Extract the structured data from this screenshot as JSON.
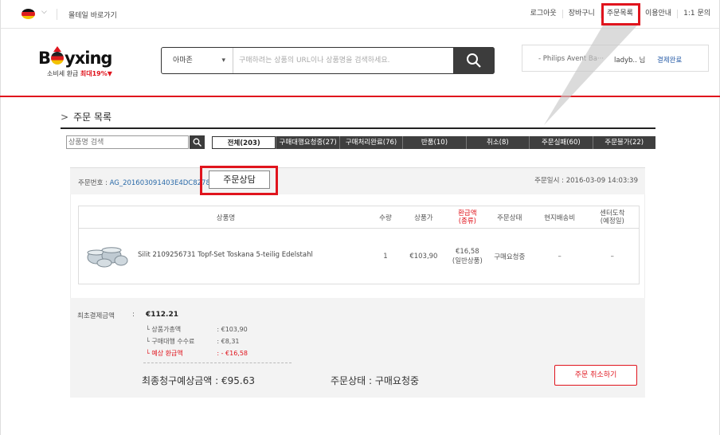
{
  "topbar": {
    "mall_link": "몰테일 바로가기",
    "nav": [
      "로그아웃",
      "장바구니",
      "주문목록",
      "이용안내",
      "1:1 문의"
    ]
  },
  "header": {
    "logo": "Byxing",
    "logo_sub_prefix": "소비세 환급 ",
    "logo_sub_highlight": "최대19%▼",
    "search_site": "아마존",
    "search_placeholder": "구매하려는 상품의 URL이나 상품명을 검색하세요.",
    "ticker_product": "- Philips Avent Ba···",
    "ticker_user": "ladyb.. 님",
    "ticker_status": "결제완료"
  },
  "page": {
    "title": "주문 목록",
    "search_placeholder": "상품명 검색",
    "tabs": [
      "전체(203)",
      "구매대행요청중(27)",
      "구매처리완료(76)",
      "반품(10)",
      "취소(8)",
      "주문실패(60)",
      "주문불가(22)"
    ]
  },
  "order": {
    "number_label": "주문번호 : ",
    "number": "AG_201603091403E4DC8278",
    "consult_button": "주문상담",
    "date": "주문일시 : 2016-03-09 14:03:39",
    "columns": [
      "상품명",
      "수량",
      "상품가",
      "환급액\n(종류)",
      "주문상태",
      "현지배송비",
      "센터도착\n(예정일)"
    ],
    "item": {
      "name": "Silit 2109256731 Topf-Set Toskana 5-teilig Edelstahl",
      "qty": "1",
      "price": "€103,90",
      "refund": "€16,58",
      "refund_type": "(일반상품)",
      "status": "구매요청중",
      "shipping": "–",
      "arrival": "–"
    }
  },
  "summary": {
    "label": "최초결제금액",
    "colon": ":",
    "total": "€112.21",
    "rows": [
      {
        "label": "상품가총액",
        "value": ": €103,90"
      },
      {
        "label": "구매대행 수수료",
        "value": ": €8,31"
      },
      {
        "label": "예상 환급액",
        "value": ": - €16,58"
      }
    ],
    "final": "최종청구예상금액 : €95.63",
    "status": "주문상태 : 구매요청중",
    "cancel_button": "주문 취소하기"
  },
  "colors": {
    "accent": "#e0141d",
    "dark": "#3f3f3f",
    "link": "#2a6aa8"
  }
}
